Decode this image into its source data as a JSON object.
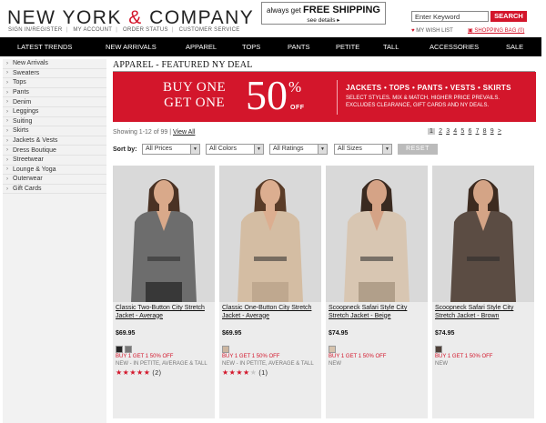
{
  "header": {
    "logo_left": "NEW YORK ",
    "logo_amp": "&",
    "logo_right": " COMPANY",
    "sign_in": "SIGN IN/REGISTER",
    "my_account": "MY ACCOUNT",
    "order_status": "ORDER STATUS",
    "customer_service": "CUSTOMER SERVICE",
    "promo_prefix": "always get",
    "promo_main": "FREE SHIPPING",
    "promo_link": "see details ▸",
    "search_placeholder": "Enter Keyword",
    "search_label": "SEARCH",
    "wishlist": "MY WISH LIST",
    "bag": "SHOPPING BAG (0)"
  },
  "nav": [
    "LATEST TRENDS",
    "NEW ARRIVALS",
    "APPAREL",
    "TOPS",
    "PANTS",
    "PETITE",
    "TALL",
    "ACCESSORIES",
    "SALE"
  ],
  "sidebar": [
    "New Arrivals",
    "Sweaters",
    "Tops",
    "Pants",
    "Denim",
    "Leggings",
    "Suiting",
    "Skirts",
    "Jackets & Vests",
    "Dress Boutique",
    "Streetwear",
    "Lounge & Yoga",
    "Outerwear",
    "Gift Cards"
  ],
  "main": {
    "title": "APPAREL - FEATURED NY DEAL",
    "banner": {
      "buy1": "BUY ONE",
      "buy2": "GET ONE",
      "fifty": "50",
      "pct": "%",
      "off": "OFF",
      "cats": "JACKETS • TOPS • PANTS • VESTS • SKIRTS",
      "fine1": "SELECT STYLES. MIX & MATCH. HIGHER PRICE PREVAILS.",
      "fine2": "EXCLUDES CLEARANCE, GIFT CARDS AND NY DEALS."
    },
    "showing": "Showing 1-12 of 99 | ",
    "view_all": "View All",
    "pages": [
      "1",
      "2",
      "3",
      "4",
      "5",
      "6",
      "7",
      "8",
      "9",
      ">"
    ],
    "sort_label": "Sort by:",
    "filters": [
      "All Prices",
      "All Colors",
      "All Ratings",
      "All Sizes"
    ],
    "reset": "RESET"
  },
  "products": [
    {
      "name": "Classic Two-Button City Stretch Jacket - Average",
      "price": "$69.95",
      "swatches": [
        "#222222",
        "#777777"
      ],
      "offer": "BUY 1 GET 1 50% OFF",
      "note": "NEW - IN PETITE, AVERAGE & TALL",
      "stars": 5,
      "reviews": "(2)",
      "jacket": "#6d6d6d",
      "skin": "#d9a98a",
      "hair": "#4a3224",
      "bottom": "#2b2b2b"
    },
    {
      "name": "Classic One-Button City Stretch Jacket - Average",
      "price": "$69.95",
      "swatches": [
        "#cdb6a0"
      ],
      "offer": "BUY 1 GET 1 50% OFF",
      "note": "NEW - IN PETITE, AVERAGE & TALL",
      "stars": 4,
      "reviews": "(1)",
      "jacket": "#d4bda3",
      "skin": "#dcae90",
      "hair": "#5a3c28",
      "bottom": "#b9a38a"
    },
    {
      "name": "Scoopneck Safari Style City Stretch Jacket - Beige",
      "price": "$74.95",
      "swatches": [
        "#d6c3ad"
      ],
      "offer": "BUY 1 GET 1 50% OFF",
      "note": "NEW",
      "stars": 0,
      "reviews": "",
      "jacket": "#d8c6b2",
      "skin": "#d5a386",
      "hair": "#3a2a20",
      "bottom": "#a8957f"
    },
    {
      "name": "Scoopneck Safari Style City Stretch Jacket - Brown",
      "price": "$74.95",
      "swatches": [
        "#4e4038"
      ],
      "offer": "BUY 1 GET 1 50% OFF",
      "note": "NEW",
      "stars": 0,
      "reviews": "",
      "jacket": "#5b4c43",
      "skin": "#d4a486",
      "hair": "#3d2b20",
      "bottom": "#5b4c43"
    }
  ]
}
